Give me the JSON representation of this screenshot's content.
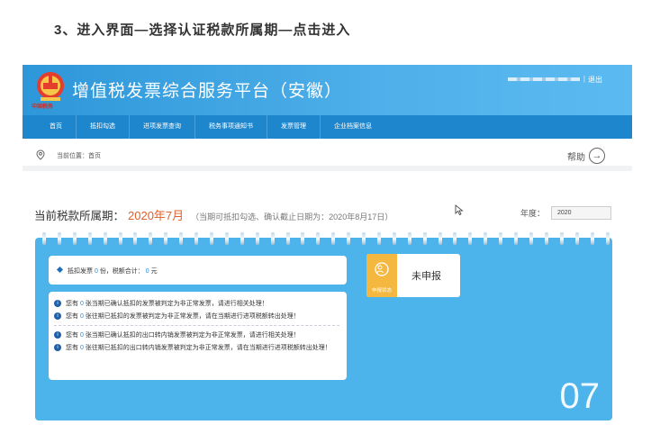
{
  "heading": "3、进入界面—选择认证税款所属期—点击进入",
  "banner": {
    "title": "增值税发票综合服务平台（安徽）",
    "logo_caption": "中国税务",
    "separator": "|",
    "logout": "退出"
  },
  "nav": [
    "首页",
    "抵扣勾选",
    "进项发票查询",
    "税务事项通知书",
    "发票管理",
    "企业档案信息"
  ],
  "breadcrumb": "当前位置：首页",
  "help": "帮助",
  "period": {
    "label": "当前税款所属期：",
    "value": "2020年7月",
    "note": "（当期可抵扣勾选、确认截止日期为：2020年8月17日）"
  },
  "year": {
    "label": "年度：",
    "value": "2020"
  },
  "summary": {
    "prefix": "抵扣发票",
    "count": "0",
    "mid": "份，税额合计：",
    "amount": "0",
    "suffix": "元"
  },
  "status": {
    "icon_label": "申报状态",
    "text": "未申报"
  },
  "notices": [
    {
      "pre": "您有",
      "count": "0",
      "text": "张当期已确认抵扣的发票被判定为非正常发票，请进行相关处理！"
    },
    {
      "pre": "您有",
      "count": "0",
      "text": "张往期已抵扣的发票被判定为非正常发票，请在当期进行进项税额转出处理！"
    },
    {
      "pre": "您有",
      "count": "0",
      "text": "张当期已确认抵扣的出口转内销发票被判定为非正常发票，请进行相关处理！"
    },
    {
      "pre": "您有",
      "count": "0",
      "text": "张往期已抵扣的出口转内销发票被判定为非正常发票，请在当期进行进项税额转出处理！"
    }
  ],
  "month_display": "07",
  "colors": {
    "accent": "#2e97d9",
    "nav": "#1e86cc",
    "calendar": "#4cb4eb",
    "period": "#e0602b",
    "status": "#f4b740"
  }
}
